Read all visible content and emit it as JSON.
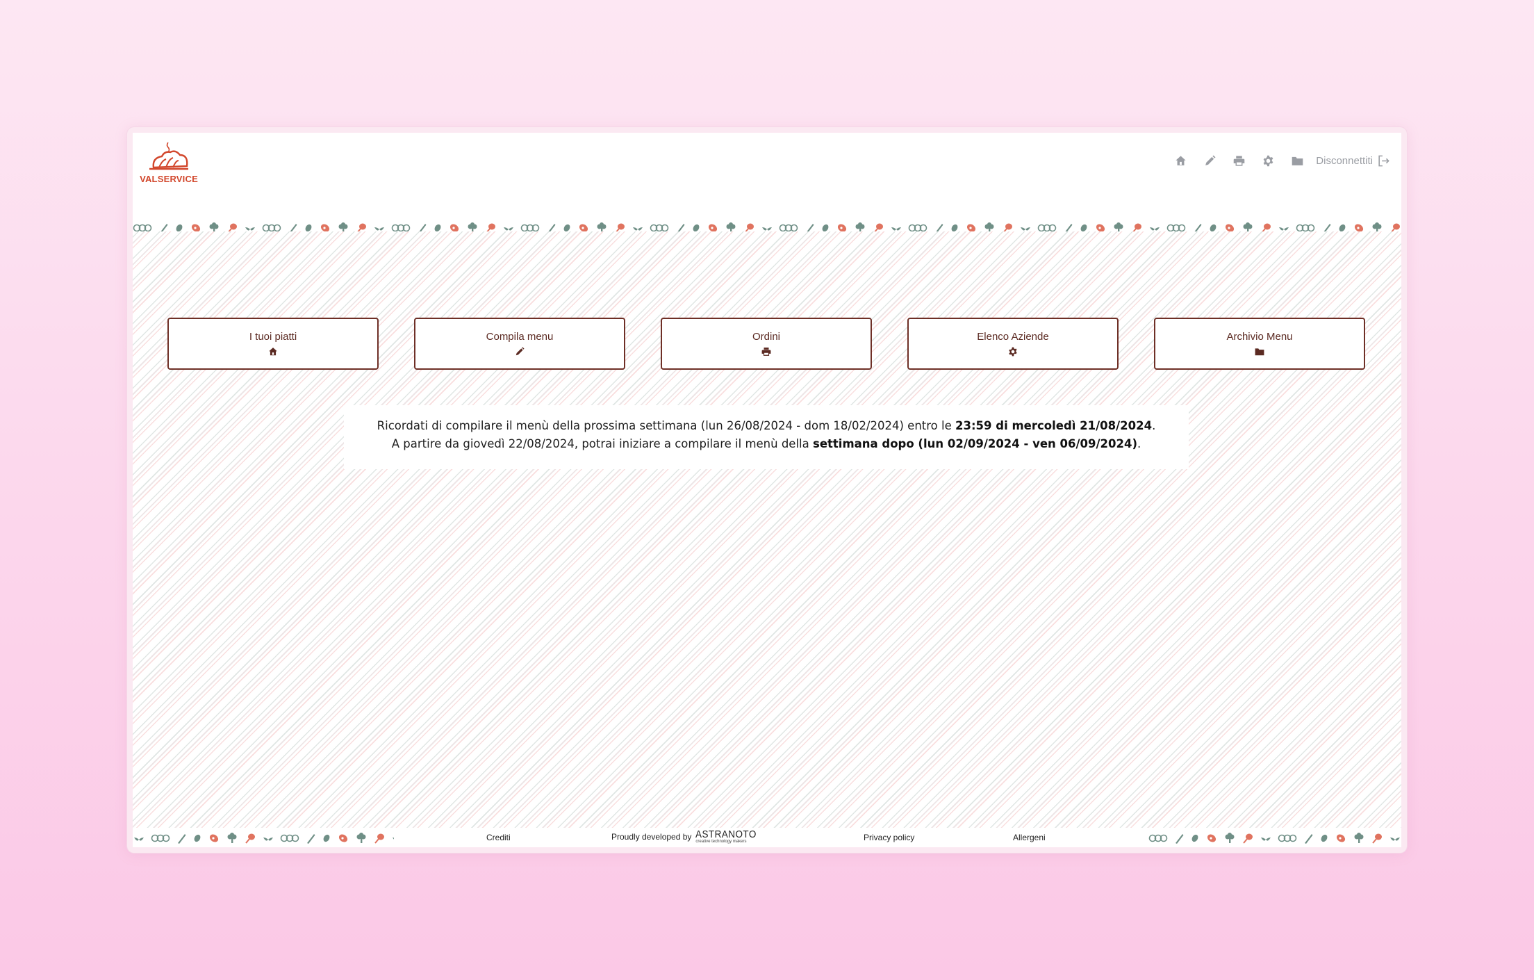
{
  "brand": {
    "name": "VALSERVICE",
    "accent": "#d2472c"
  },
  "header": {
    "nav_icons": [
      "home-icon",
      "pencil-icon",
      "print-icon",
      "gear-icon",
      "folder-icon"
    ],
    "logout_label": "Disconnettiti",
    "icon_color": "#9a9da3"
  },
  "menu_cards": [
    {
      "label": "I tuoi piatti",
      "icon": "home-icon"
    },
    {
      "label": "Compila menu",
      "icon": "pencil-icon"
    },
    {
      "label": "Ordini",
      "icon": "print-icon"
    },
    {
      "label": "Elenco Aziende",
      "icon": "gear-icon"
    },
    {
      "label": "Archivio Menu",
      "icon": "folder-icon"
    }
  ],
  "notice": {
    "line1_pre": "Ricordati di compilare il menù della prossima settimana (lun 26/08/2024 - dom 18/02/2024) entro le ",
    "line1_bold": "23:59 di mercoledì 21/08/2024",
    "line1_post": ".",
    "line2_pre": "A partire da giovedì 22/08/2024, potrai iniziare a compilare il menù della ",
    "line2_bold": "settimana dopo (lun 02/09/2024 - ven 06/09/2024)",
    "line2_post": "."
  },
  "footer": {
    "credits": "Crediti",
    "developed_by": "Proudly developed by",
    "developer_name": "ASTRANOTO",
    "developer_tagline": "creative technology makers",
    "privacy": "Privacy policy",
    "allergens": "Allergeni"
  },
  "colors": {
    "card_border": "#6e2f26",
    "card_text": "#5b2a22",
    "food_green": "#6f8f86",
    "food_red": "#e0735f"
  }
}
